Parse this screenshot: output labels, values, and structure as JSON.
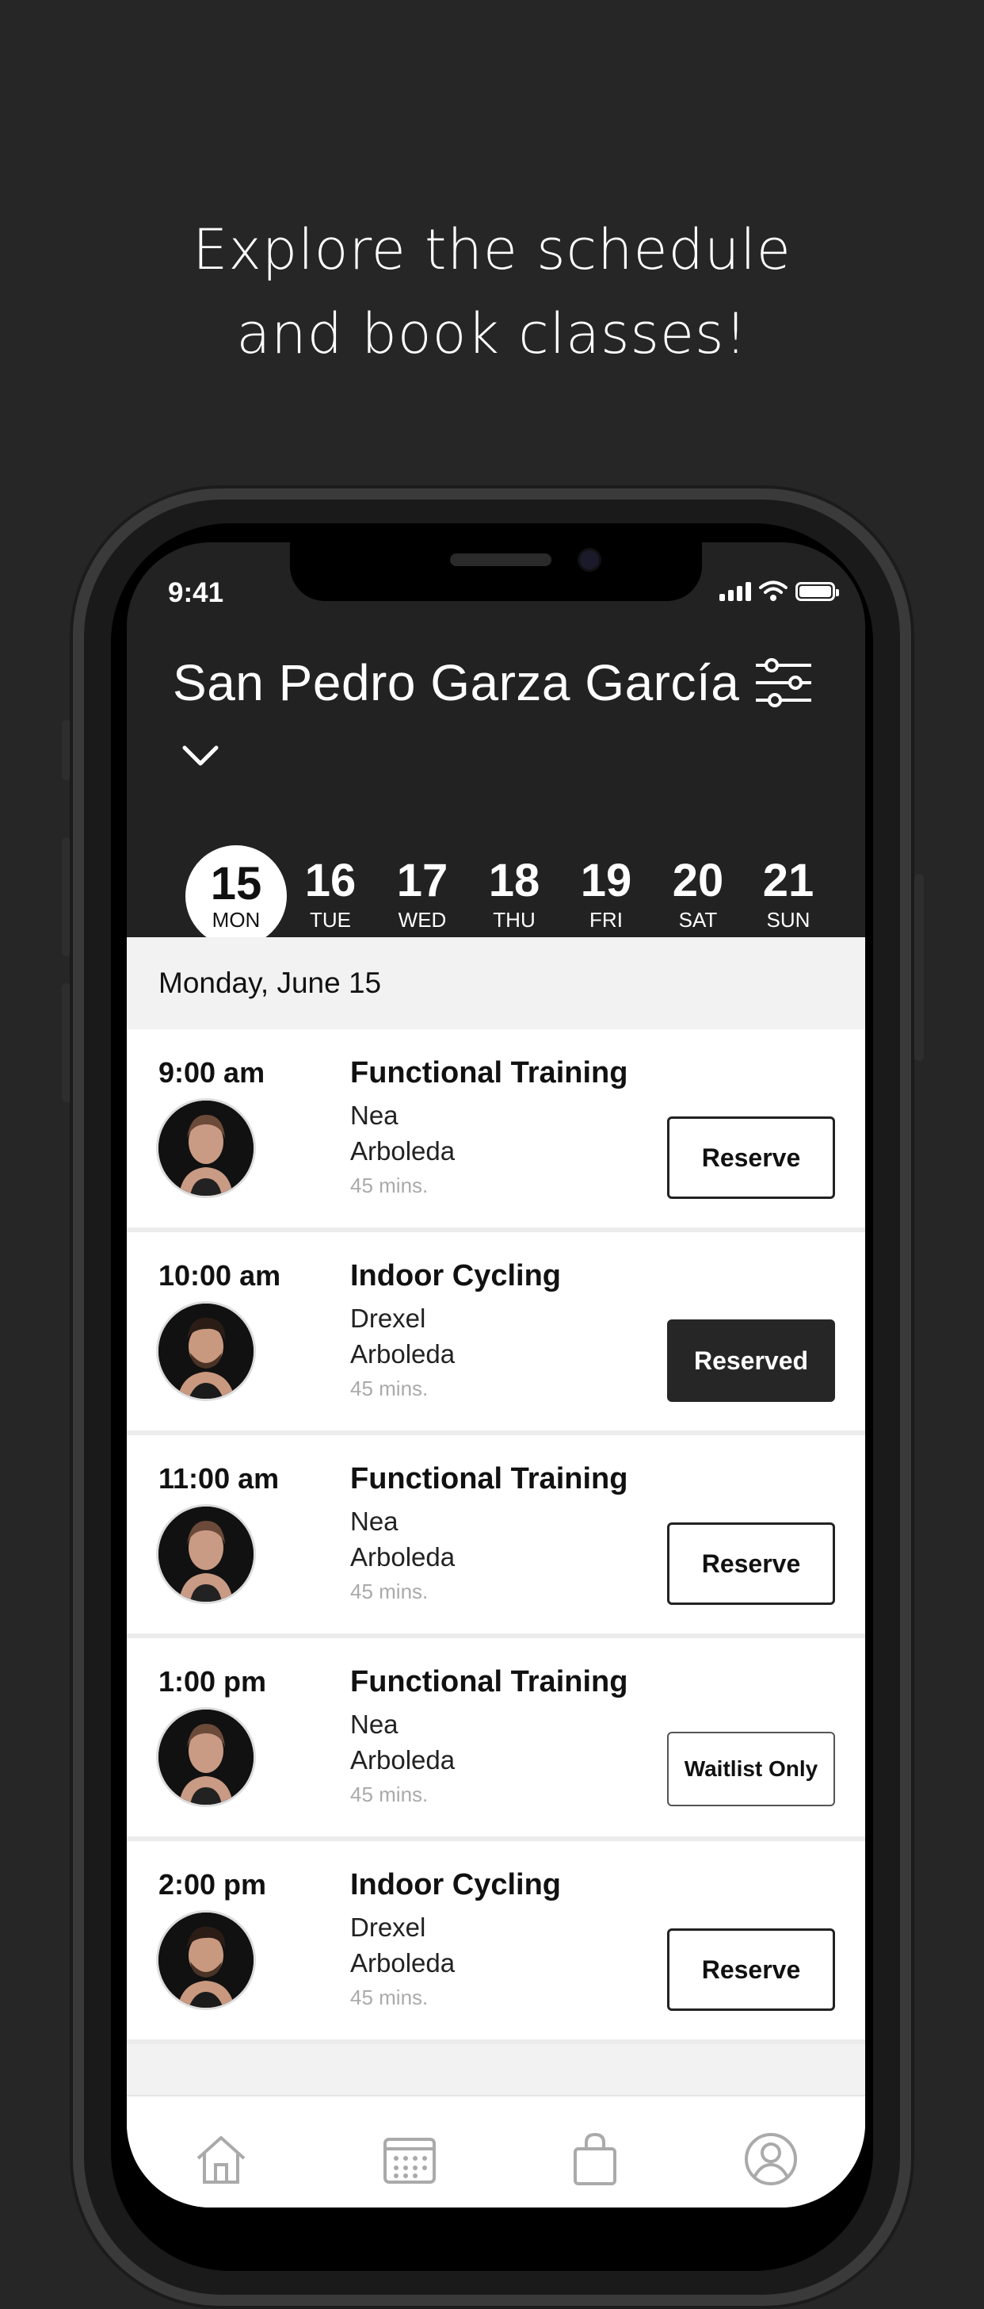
{
  "promo": {
    "line1": "Explore the schedule",
    "line2": "and book classes!"
  },
  "status_bar": {
    "time": "9:41",
    "icons": [
      "signal-icon",
      "wifi-icon",
      "battery-icon"
    ]
  },
  "header": {
    "location": "San Pedro Garza García",
    "filter_icon": "sliders-icon",
    "dropdown_icon": "chevron-down-icon"
  },
  "dates": [
    {
      "num": "15",
      "dow": "MON",
      "selected": true
    },
    {
      "num": "16",
      "dow": "TUE",
      "selected": false
    },
    {
      "num": "17",
      "dow": "WED",
      "selected": false
    },
    {
      "num": "18",
      "dow": "THU",
      "selected": false
    },
    {
      "num": "19",
      "dow": "FRI",
      "selected": false
    },
    {
      "num": "20",
      "dow": "SAT",
      "selected": false
    },
    {
      "num": "21",
      "dow": "SUN",
      "selected": false
    }
  ],
  "schedule": {
    "day_label": "Monday, June 15",
    "classes": [
      {
        "time": "9:00 am",
        "title": "Functional Training",
        "instructor_first": "Nea",
        "location": "Arboleda",
        "duration": "45 mins.",
        "button": "Reserve",
        "button_style": "outline"
      },
      {
        "time": "10:00 am",
        "title": "Indoor Cycling",
        "instructor_first": "Drexel",
        "location": "Arboleda",
        "duration": "45 mins.",
        "button": "Reserved",
        "button_style": "filled"
      },
      {
        "time": "11:00 am",
        "title": "Functional Training",
        "instructor_first": "Nea",
        "location": "Arboleda",
        "duration": "45 mins.",
        "button": "Reserve",
        "button_style": "outline"
      },
      {
        "time": "1:00 pm",
        "title": "Functional Training",
        "instructor_first": "Nea",
        "location": "Arboleda",
        "duration": "45 mins.",
        "button": "Waitlist Only",
        "button_style": "outline-small"
      },
      {
        "time": "2:00 pm",
        "title": "Indoor Cycling",
        "instructor_first": "Drexel",
        "location": "Arboleda",
        "duration": "45 mins.",
        "button": "Reserve",
        "button_style": "outline"
      }
    ]
  },
  "tabbar": {
    "tabs": [
      "home-icon",
      "calendar-icon",
      "shopping-bag-icon",
      "profile-icon"
    ]
  },
  "colors": {
    "background": "#262626",
    "accent_dark": "#262626",
    "list_background": "#f2f2f2"
  }
}
